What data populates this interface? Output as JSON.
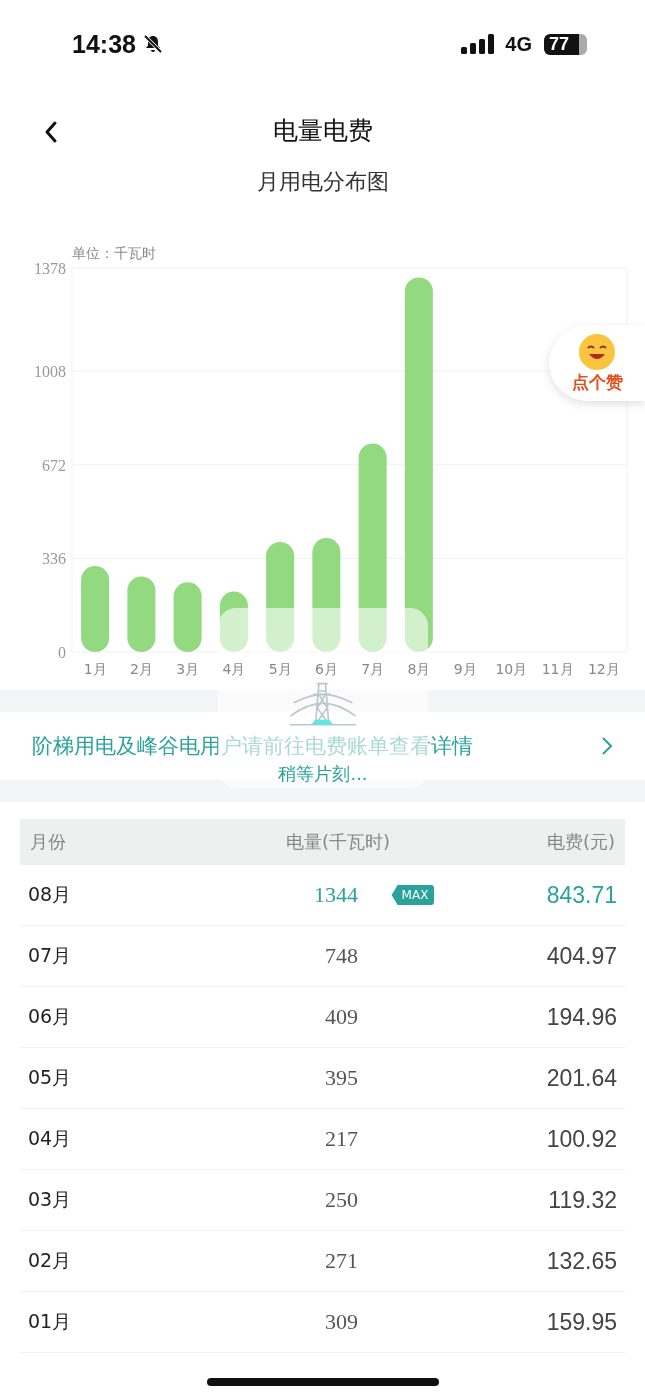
{
  "status_bar": {
    "time": "14:38",
    "network": "4G",
    "battery": "77"
  },
  "nav": {
    "title": "电量电费"
  },
  "chart_card": {
    "title": "月用电分布图",
    "unit": "单位：千瓦时",
    "chart_data": {
      "type": "bar",
      "grid": true,
      "categories": [
        "1月",
        "2月",
        "3月",
        "4月",
        "5月",
        "6月",
        "7月",
        "8月",
        "9月",
        "10月",
        "11月",
        "12月"
      ],
      "series": [
        {
          "color": "#92d97f",
          "values": [
            309,
            271,
            250,
            217,
            395,
            409,
            748,
            1344,
            null,
            null,
            null,
            null
          ]
        }
      ],
      "ylim": [
        0,
        1378
      ],
      "yticks": [
        0,
        336,
        672,
        1008,
        1378
      ]
    }
  },
  "like_badge": {
    "label": "点个赞"
  },
  "loading": {
    "text": "稍等片刻..."
  },
  "banner": {
    "text": "阶梯用电及峰谷电用户请前往电费账单查看详情"
  },
  "table": {
    "columns": [
      "月份",
      "电量(千瓦时)",
      "电费(元)"
    ],
    "max_badge": "MAX",
    "rows": [
      {
        "month": "08月",
        "usage": "1344",
        "fee": "843.71",
        "max": true
      },
      {
        "month": "07月",
        "usage": "748",
        "fee": "404.97",
        "max": false
      },
      {
        "month": "06月",
        "usage": "409",
        "fee": "194.96",
        "max": false
      },
      {
        "month": "05月",
        "usage": "395",
        "fee": "201.64",
        "max": false
      },
      {
        "month": "04月",
        "usage": "217",
        "fee": "100.92",
        "max": false
      },
      {
        "month": "03月",
        "usage": "250",
        "fee": "119.32",
        "max": false
      },
      {
        "month": "02月",
        "usage": "271",
        "fee": "132.65",
        "max": false
      },
      {
        "month": "01月",
        "usage": "309",
        "fee": "159.95",
        "max": false
      }
    ]
  }
}
